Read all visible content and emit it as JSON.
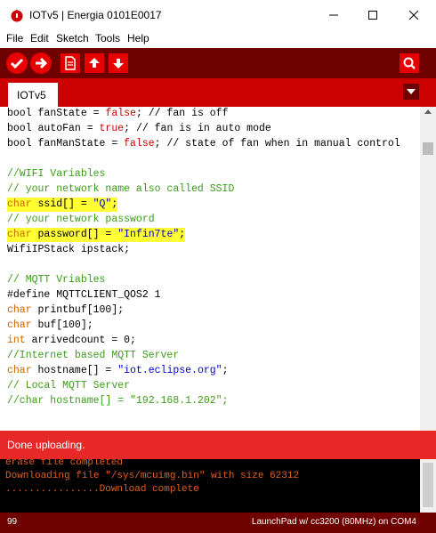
{
  "window": {
    "title": "IOTv5 | Energia 0101E0017",
    "minimize_label": "—",
    "maximize_label": "☐",
    "close_label": "✕"
  },
  "menu": [
    "File",
    "Edit",
    "Sketch",
    "Tools",
    "Help"
  ],
  "toolbar": {
    "buttons": [
      "verify-icon",
      "upload-icon",
      "new-file-icon",
      "open-icon",
      "save-icon"
    ],
    "serial_monitor": "search-icon"
  },
  "tab": {
    "label": "IOTv5"
  },
  "code": {
    "line1_kw": "bool",
    "line1_a": " fanState = ",
    "line1_b": "false",
    "line1_c": "; // fan is off",
    "line2_kw": "bool",
    "line2_a": " autoFan = ",
    "line2_b": "true",
    "line2_c": "; // fan is in auto mode",
    "line3_kw": "bool",
    "line3_a": " fanManState = ",
    "line3_b": "false",
    "line3_c": "; // state of fan when in manual control",
    "line4": "//WIFI Variables",
    "line5": "// your network name also called SSID",
    "line6_kw": "char",
    "line6_a": " ssid[] = ",
    "line6_b": "\"Q\"",
    "line6_c": ";",
    "line7": "// your network password",
    "line8_kw": "char",
    "line8_a": " password[] = ",
    "line8_b": "\"Infin7te\"",
    "line8_c": ";",
    "line9": "WifiIPStack ipstack;",
    "line10": "// MQTT Vriables",
    "line11": "#define MQTTCLIENT_QOS2 1",
    "line12_kw": "char",
    "line12_a": " printbuf[100];",
    "line13_kw": "char",
    "line13_a": " buf[100];",
    "line14_kw": "int",
    "line14_a": " arrivedcount = 0;",
    "line15": "//Internet based MQTT Server",
    "line16_kw": "char",
    "line16_a": " hostname[] = ",
    "line16_b": "\"iot.eclipse.org\"",
    "line16_c": ";",
    "line17": "// Local MQTT Server",
    "line18": "//char hostname[] = \"192.168.1.202\";"
  },
  "status": {
    "message": "Done uploading."
  },
  "console": {
    "lines": [
      "erase file completed",
      "Downloading file \"/sys/mcuimg.bin\" with size 62312",
      "................Download complete"
    ]
  },
  "footer": {
    "line_number": "99",
    "board": "LaunchPad w/ cc3200 (80MHz) on COM4"
  },
  "colors": {
    "toolbar_bg": "#6e0000",
    "tab_bar_bg": "#cc0000",
    "status_bg": "#e62828",
    "button_red": "#e60000",
    "highlight": "#ffff33"
  }
}
